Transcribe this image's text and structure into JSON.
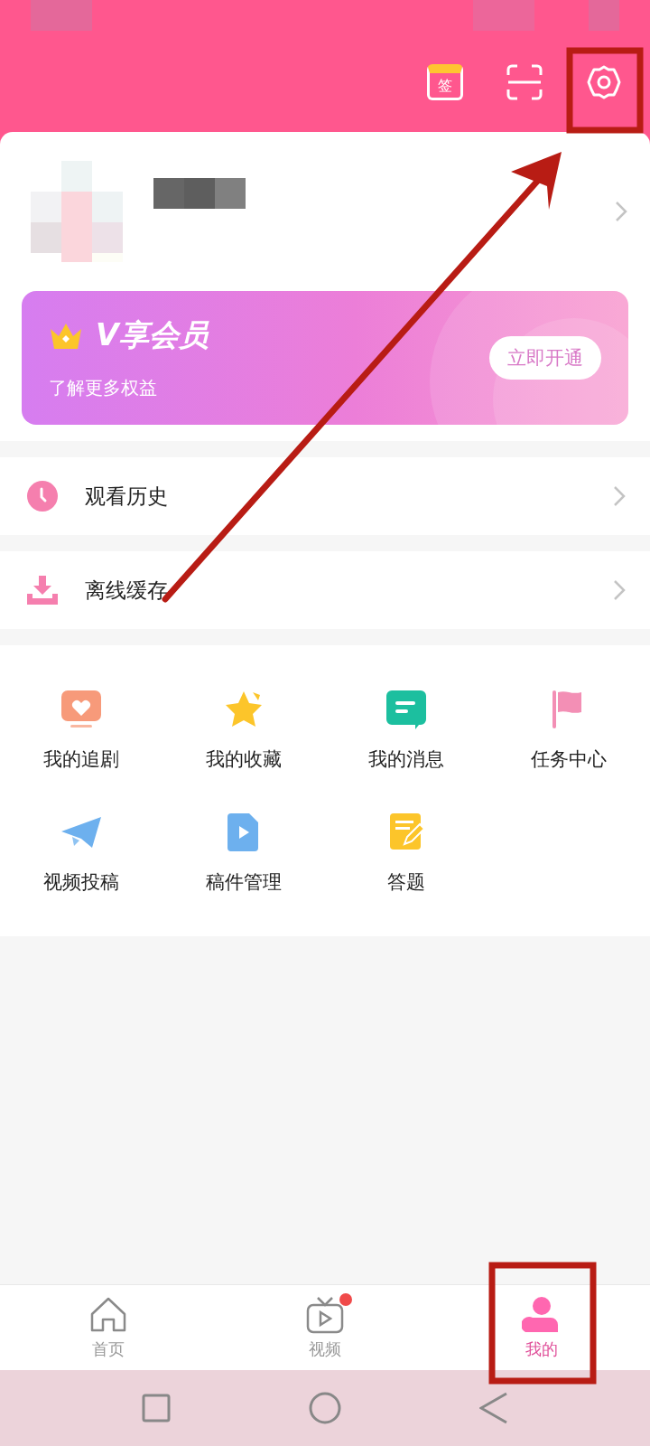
{
  "header": {
    "sign_in_label": "签"
  },
  "vip": {
    "title": "V享会员",
    "subtitle": "了解更多权益",
    "button": "立即开通"
  },
  "menu_rows": [
    {
      "kind": "history",
      "label": "观看历史"
    },
    {
      "kind": "download",
      "label": "离线缓存"
    }
  ],
  "shortcuts": [
    {
      "kind": "heart-tv",
      "label": "我的追剧"
    },
    {
      "kind": "star",
      "label": "我的收藏"
    },
    {
      "kind": "message",
      "label": "我的消息"
    },
    {
      "kind": "flag",
      "label": "任务中心"
    },
    {
      "kind": "plane",
      "label": "视频投稿"
    },
    {
      "kind": "video-file",
      "label": "稿件管理"
    },
    {
      "kind": "notepad",
      "label": "答题"
    }
  ],
  "tabs": [
    {
      "kind": "home",
      "label": "首页",
      "selected": false,
      "badge": false
    },
    {
      "kind": "video",
      "label": "视频",
      "selected": false,
      "badge": true
    },
    {
      "kind": "me",
      "label": "我的",
      "selected": true,
      "badge": false
    }
  ]
}
